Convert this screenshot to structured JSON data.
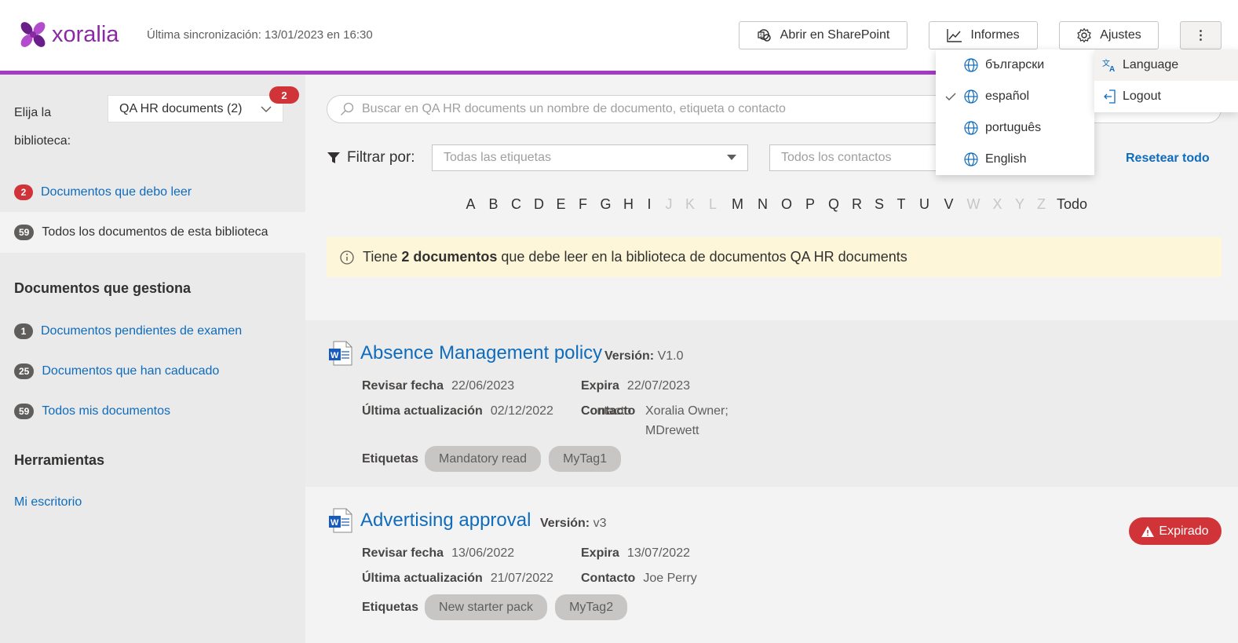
{
  "header": {
    "logo_text": "xoralia",
    "sync_text": "Última sincronización: 13/01/2023 en 16:30",
    "sharepoint_label": "Abrir en SharePoint",
    "reports_label": "Informes",
    "settings_label": "Ajustes",
    "more_label": "⋮",
    "accent_color": "#a23bc6"
  },
  "sidebar": {
    "library_label": "Elija la biblioteca:",
    "library_value": "QA HR documents (2)",
    "library_badge": "2",
    "read_items": [
      {
        "count": "2",
        "label": "Documentos que debo leer"
      },
      {
        "count": "59",
        "label": "Todos los documentos de esta biblioteca"
      }
    ],
    "managed_heading": "Documentos que gestiona",
    "managed_items": [
      {
        "count": "1",
        "label": "Documentos pendientes de examen"
      },
      {
        "count": "25",
        "label": "Documentos que han caducado"
      },
      {
        "count": "59",
        "label": "Todos mis documentos"
      }
    ],
    "tools_heading": "Herramientas",
    "tools_items": [
      {
        "label": "Mi escritorio"
      }
    ]
  },
  "main": {
    "search_placeholder": "Buscar en QA HR documents un nombre de documento, etiqueta o contacto",
    "filter_label": "Filtrar por:",
    "tags_placeholder": "Todas las etiquetas",
    "contacts_placeholder": "Todos los contactos",
    "reset_label": "Resetear todo",
    "alphabet": [
      {
        "l": "A",
        "on": true
      },
      {
        "l": "B",
        "on": true
      },
      {
        "l": "C",
        "on": true
      },
      {
        "l": "D",
        "on": true
      },
      {
        "l": "E",
        "on": true
      },
      {
        "l": "F",
        "on": true
      },
      {
        "l": "G",
        "on": true
      },
      {
        "l": "H",
        "on": true
      },
      {
        "l": "I",
        "on": true
      },
      {
        "l": "J",
        "on": false
      },
      {
        "l": "K",
        "on": false
      },
      {
        "l": "L",
        "on": false
      },
      {
        "l": "M",
        "on": true
      },
      {
        "l": "N",
        "on": true
      },
      {
        "l": "O",
        "on": true
      },
      {
        "l": "P",
        "on": true
      },
      {
        "l": "Q",
        "on": true
      },
      {
        "l": "R",
        "on": true
      },
      {
        "l": "S",
        "on": true
      },
      {
        "l": "T",
        "on": true
      },
      {
        "l": "U",
        "on": true
      },
      {
        "l": "V",
        "on": true
      },
      {
        "l": "W",
        "on": false
      },
      {
        "l": "X",
        "on": false
      },
      {
        "l": "Y",
        "on": false
      },
      {
        "l": "Z",
        "on": false
      }
    ],
    "alphabet_all": "Todo",
    "notice": {
      "pre": "Tiene ",
      "bold": "2 documentos",
      "post": " que debe leer en la biblioteca de documentos QA HR documents"
    }
  },
  "labels": {
    "version": "Versión:",
    "review_date": "Revisar fecha",
    "expires": "Expira",
    "last_update": "Última actualización",
    "contact": "Contacto",
    "tags": "Etiquetas"
  },
  "documents": [
    {
      "title": "Absence Management policy",
      "version": "V1.0",
      "review_date": "22/06/2023",
      "expires": "22/07/2023",
      "last_update": "02/12/2022",
      "contact_line1": "Xoralia Owner;",
      "contact_line2": "MDrewett",
      "tags": [
        "Mandatory read",
        "MyTag1"
      ]
    },
    {
      "title": "Advertising approval",
      "version": "v3",
      "review_date": "13/06/2022",
      "expires": "13/07/2022",
      "last_update": "21/07/2022",
      "contact_line1": "Joe Perry",
      "tags": [
        "New starter pack",
        "MyTag2"
      ],
      "status": "Expirado"
    }
  ],
  "language_menu": {
    "items": [
      "български",
      "español",
      "português",
      "English"
    ],
    "selected": "español"
  },
  "more_menu": {
    "items": [
      "Language",
      "Logout"
    ]
  }
}
